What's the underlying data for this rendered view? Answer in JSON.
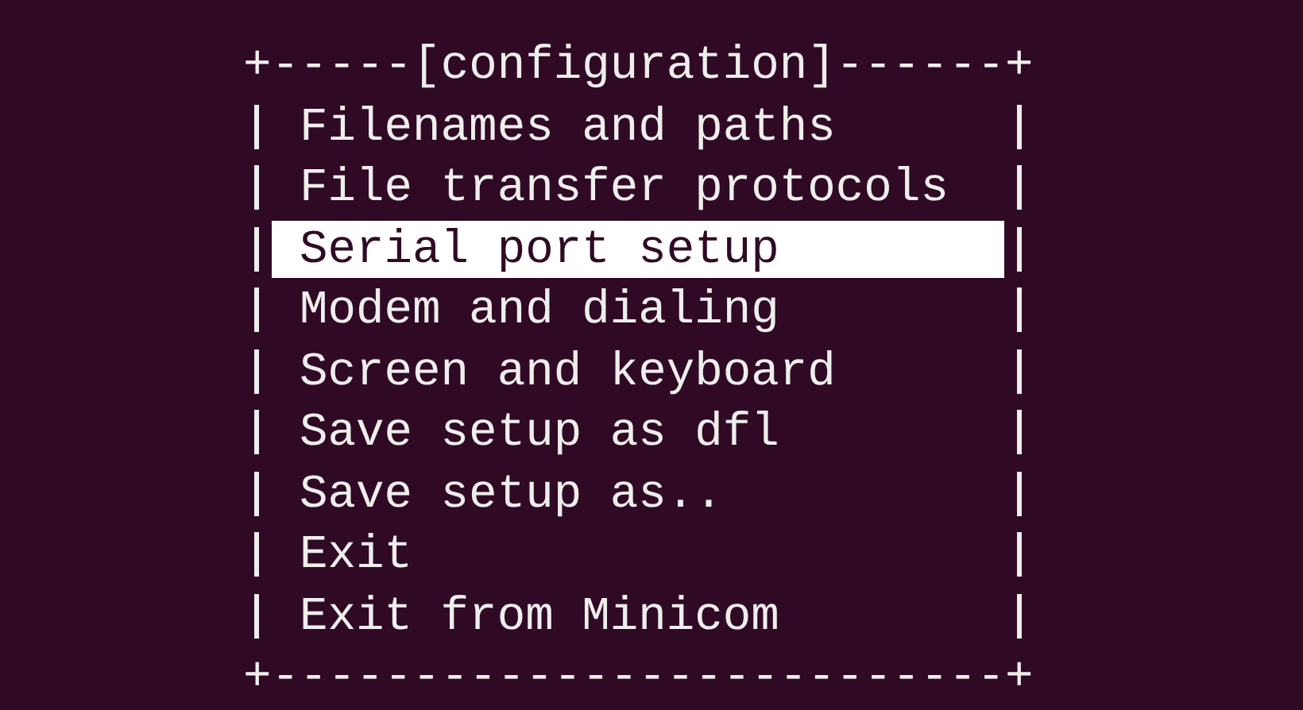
{
  "menu": {
    "border_top_left": "+-----",
    "title": "[configuration]",
    "border_top_right": "------+",
    "items": [
      {
        "label": "Filenames and paths",
        "selected": false
      },
      {
        "label": "File transfer protocols",
        "selected": false
      },
      {
        "label": "Serial port setup",
        "selected": true
      },
      {
        "label": "Modem and dialing",
        "selected": false
      },
      {
        "label": "Screen and keyboard",
        "selected": false
      },
      {
        "label": "Save setup as dfl",
        "selected": false
      },
      {
        "label": "Save setup as..",
        "selected": false
      },
      {
        "label": "Exit",
        "selected": false
      },
      {
        "label": "Exit from Minicom",
        "selected": false
      }
    ],
    "border_bottom": "+--------------------------+"
  }
}
